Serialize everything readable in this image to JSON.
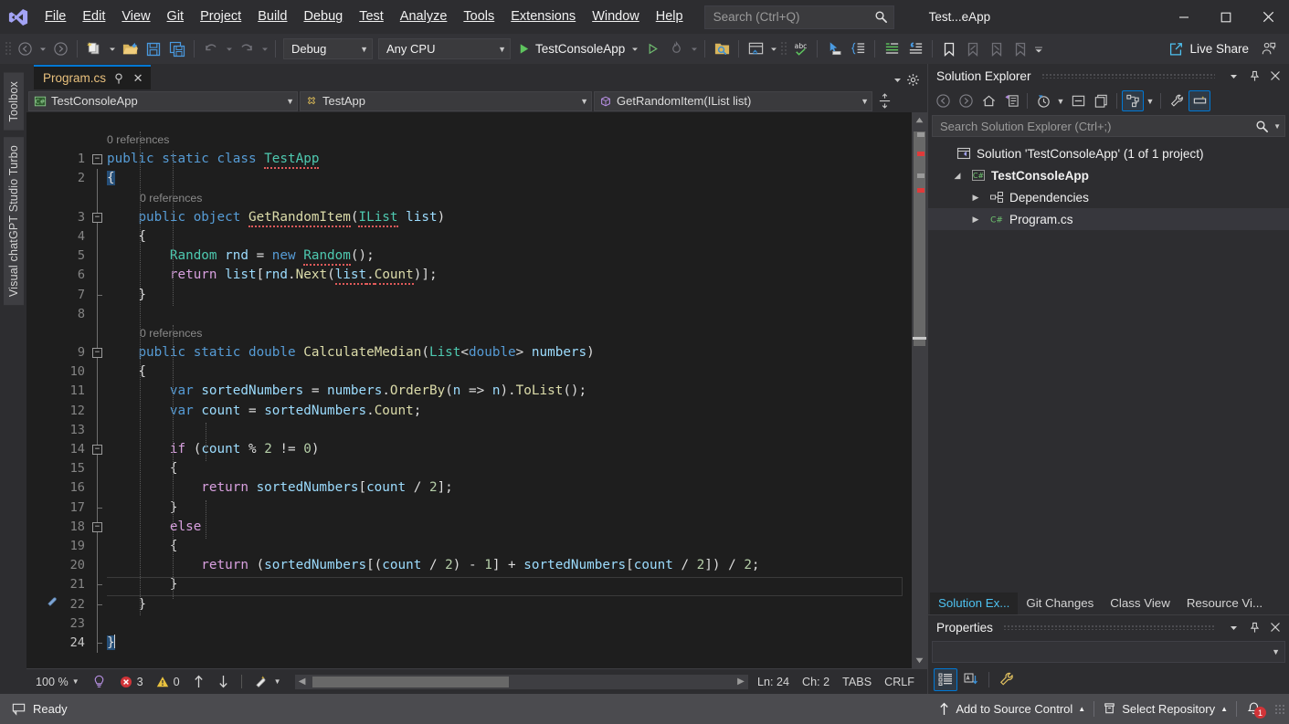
{
  "window": {
    "title": "Test...eApp",
    "logo_icon": "visual-studio-logo",
    "minimize_icon": "minimize-icon",
    "maximize_icon": "maximize-icon",
    "close_icon": "close-icon"
  },
  "menu": {
    "items": [
      {
        "label": "File",
        "accel": "F"
      },
      {
        "label": "Edit",
        "accel": "E"
      },
      {
        "label": "View",
        "accel": "V"
      },
      {
        "label": "Git",
        "accel": "G"
      },
      {
        "label": "Project",
        "accel": "P"
      },
      {
        "label": "Build",
        "accel": "B"
      },
      {
        "label": "Debug",
        "accel": "D"
      },
      {
        "label": "Test",
        "accel": "T"
      },
      {
        "label": "Analyze",
        "accel": "n"
      },
      {
        "label": "Tools",
        "accel": "T"
      },
      {
        "label": "Extensions",
        "accel": "x"
      },
      {
        "label": "Window",
        "accel": "W"
      },
      {
        "label": "Help",
        "accel": "H"
      }
    ]
  },
  "search": {
    "placeholder": "Search (Ctrl+Q)",
    "icon": "search-icon"
  },
  "toolbar": {
    "navigate_back_icon": "navigate-back-icon",
    "navigate_forward_icon": "navigate-forward-icon",
    "new_project_icon": "new-project-icon",
    "open_file_icon": "open-file-icon",
    "save_icon": "save-icon",
    "save_all_icon": "save-all-icon",
    "undo_icon": "undo-icon",
    "redo_icon": "redo-icon",
    "config_label": "Debug",
    "platform_label": "Any CPU",
    "run_label": "TestConsoleApp",
    "run_icon": "play-icon",
    "hot_reload_icon": "hot-reload-icon",
    "find_in_files_icon": "find-in-files-icon",
    "window_layout_icon": "window-layout-icon",
    "spell_check_icon": "spell-check-abc-icon",
    "select_tool_icon": "pointer-select-icon",
    "toggle_structure_icon": "structure-guides-icon",
    "comment_icon": "comment-lines-icon",
    "uncomment_icon": "uncomment-lines-icon",
    "bookmark_icon": "bookmark-icon",
    "prev_bookmark_icon": "previous-bookmark-icon",
    "next_bookmark_icon": "next-bookmark-icon",
    "clear_bookmark_icon": "clear-bookmark-icon",
    "overflow_icon": "toolbar-overflow-icon",
    "live_share_label": "Live Share",
    "live_share_icon": "live-share-icon",
    "feedback_icon": "send-feedback-icon"
  },
  "left_dock": {
    "tabs": [
      {
        "label": "Toolbox"
      },
      {
        "label": "Visual chatGPT Studio Turbo"
      }
    ]
  },
  "editor": {
    "tab": {
      "filename": "Program.cs",
      "pin_icon": "pin-icon",
      "close_icon": "close-icon"
    },
    "tabstrip": {
      "dropdown_icon": "tab-list-dropdown-icon",
      "settings_icon": "gear-icon"
    },
    "navbar": {
      "project": "TestConsoleApp",
      "project_icon": "csharp-project-icon",
      "type": "TestApp",
      "type_icon": "class-icon",
      "member": "GetRandomItem(IList list)",
      "member_icon": "method-icon",
      "split_icon": "split-view-icon"
    },
    "codelens": {
      "class_refs": "0 references",
      "method1_refs": "0 references",
      "method2_refs": "0 references"
    },
    "line_numbers": [
      "1",
      "2",
      "3",
      "4",
      "5",
      "6",
      "7",
      "8",
      "9",
      "10",
      "11",
      "12",
      "13",
      "14",
      "15",
      "16",
      "17",
      "18",
      "19",
      "20",
      "21",
      "22",
      "23",
      "24"
    ],
    "code": {
      "line1": "public static class TestApp",
      "line2": "{",
      "line3": "    public object GetRandomItem(IList list)",
      "line4": "    {",
      "line5": "        Random rnd = new Random();",
      "line6": "        return list[rnd.Next(list.Count)];",
      "line7": "    }",
      "line8": "",
      "line9": "    public static double CalculateMedian(List<double> numbers)",
      "line10": "    {",
      "line11": "        var sortedNumbers = numbers.OrderBy(n => n).ToList();",
      "line12": "        var count = sortedNumbers.Count;",
      "line13": "",
      "line14": "        if (count % 2 != 0)",
      "line15": "        {",
      "line16": "            return sortedNumbers[count / 2];",
      "line17": "        }",
      "line18": "        else",
      "line19": "        {",
      "line20": "            return (sortedNumbers[(count / 2) - 1] + sortedNumbers[count / 2]) / 2;",
      "line21": "        }",
      "line22": "    }",
      "line23": "",
      "line24": "}"
    },
    "status": {
      "zoom": "100 %",
      "zoom_caret_icon": "chevron-down-icon",
      "intellicode_icon": "intellicode-icon",
      "error_count": "3",
      "error_icon": "error-icon",
      "warning_count": "0",
      "warning_icon": "warning-icon",
      "prev_issue_icon": "arrow-up-icon",
      "next_issue_icon": "arrow-down-icon",
      "quick_actions_icon": "quick-actions-icon",
      "line_label": "Ln: 24",
      "char_label": "Ch: 2",
      "indent_label": "TABS",
      "eol_label": "CRLF",
      "scroll_left_icon": "scroll-left-icon",
      "scroll_right_icon": "scroll-right-icon"
    }
  },
  "solution_explorer": {
    "title": "Solution Explorer",
    "dropdown_icon": "chevron-down-icon",
    "pin_icon": "pin-icon",
    "close_icon": "close-icon",
    "toolbar": {
      "back_icon": "navigate-back-icon",
      "forward_icon": "navigate-forward-icon",
      "home_icon": "home-icon",
      "pending_changes_icon": "pending-changes-filter-icon",
      "history_icon": "history-clock-icon",
      "history_caret_icon": "chevron-down-icon",
      "collapse_all_icon": "collapse-all-icon",
      "show_all_files_icon": "show-all-files-icon",
      "solution_view_icon": "switch-views-icon",
      "solution_view_caret_icon": "chevron-down-icon",
      "properties_icon": "wrench-properties-icon",
      "preview_icon": "preview-selected-items-icon"
    },
    "search_placeholder": "Search Solution Explorer (Ctrl+;)",
    "search_icon": "search-icon",
    "search_caret_icon": "chevron-down-icon",
    "tree": [
      {
        "label": "Solution 'TestConsoleApp' (1 of 1 project)",
        "icon": "solution-icon",
        "indent": 0,
        "arrow": "",
        "bold": false,
        "selected": false
      },
      {
        "label": "TestConsoleApp",
        "icon": "csharp-project-icon",
        "indent": 1,
        "arrow": "expanded",
        "bold": true,
        "selected": false
      },
      {
        "label": "Dependencies",
        "icon": "dependencies-icon",
        "indent": 2,
        "arrow": "collapsed",
        "bold": false,
        "selected": false
      },
      {
        "label": "Program.cs",
        "icon": "csharp-file-icon",
        "indent": 2,
        "arrow": "collapsed",
        "bold": false,
        "selected": true
      }
    ]
  },
  "pane_tabs": [
    {
      "label": "Solution Ex...",
      "active": true
    },
    {
      "label": "Git Changes",
      "active": false
    },
    {
      "label": "Class View",
      "active": false
    },
    {
      "label": "Resource Vi...",
      "active": false
    }
  ],
  "properties": {
    "title": "Properties",
    "dropdown_icon": "chevron-down-icon",
    "pin_icon": "pin-icon",
    "close_icon": "close-icon",
    "selector_caret_icon": "chevron-down-icon",
    "categorized_icon": "categorized-view-icon",
    "alphabetical_icon": "alphabetical-view-icon",
    "properties_icon": "properties-wrench-icon"
  },
  "statusbar": {
    "ready_label": "Ready",
    "ready_icon": "status-ready-icon",
    "add_to_source_control": "Add to Source Control",
    "add_to_source_control_icon": "arrow-up-icon",
    "add_caret_icon": "chevron-up-icon",
    "select_repository": "Select Repository",
    "select_repository_icon": "repository-icon",
    "repo_caret_icon": "chevron-up-icon",
    "notification_icon": "bell-icon",
    "notification_count": "1"
  },
  "colors": {
    "accent": "#0078d4",
    "tab_accent": "#0078d4",
    "editor_bg": "#1e1e1e",
    "chrome_bg": "#2d2d30",
    "statusbar_bg": "#4b4b4f",
    "keyword": "#569cd6",
    "control_keyword": "#d8a0df",
    "type": "#4ec9b0",
    "method": "#dcdcaa",
    "identifier": "#9cdcfe",
    "number": "#b5cea8",
    "error": "#d13438",
    "link": "#4ec2f1"
  }
}
